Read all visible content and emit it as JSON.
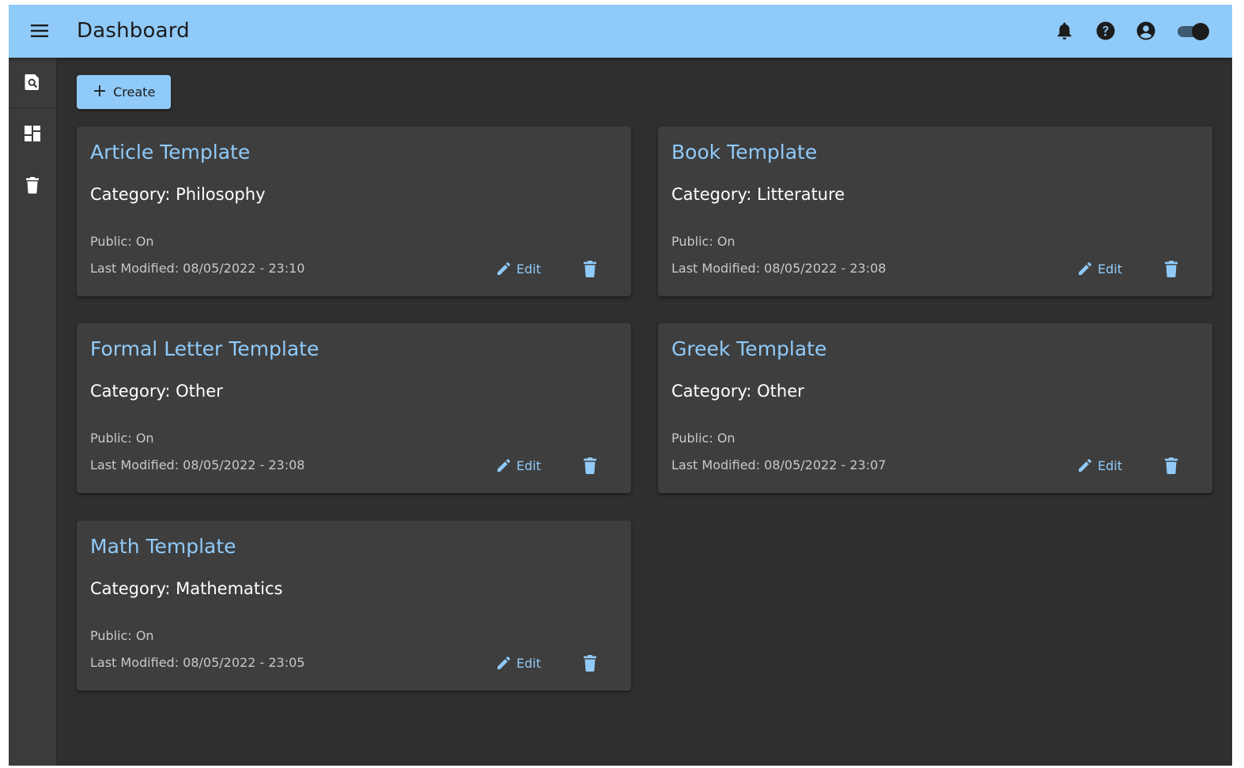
{
  "header": {
    "title": "Dashboard",
    "menu_icon": "hamburger-menu-icon",
    "icons": [
      "bell-icon",
      "help-circle-icon",
      "account-circle-icon"
    ],
    "theme_toggle": {
      "on": true
    }
  },
  "sidebar": {
    "items": [
      {
        "icon": "file-search-icon"
      },
      {
        "icon": "dashboard-icon"
      },
      {
        "icon": "trash-icon"
      }
    ]
  },
  "toolbar": {
    "create_label": "Create",
    "create_icon": "plus-icon"
  },
  "cards": [
    {
      "title": "Article Template",
      "category": "Category: Philosophy",
      "public": "Public: On",
      "modified": "Last Modified: 08/05/2022 - 23:10",
      "edit_label": "Edit"
    },
    {
      "title": "Book Template",
      "category": "Category: Litterature",
      "public": "Public: On",
      "modified": "Last Modified: 08/05/2022 - 23:08",
      "edit_label": "Edit"
    },
    {
      "title": "Formal Letter Template",
      "category": "Category: Other",
      "public": "Public: On",
      "modified": "Last Modified: 08/05/2022 - 23:08",
      "edit_label": "Edit"
    },
    {
      "title": "Greek Template",
      "category": "Category: Other",
      "public": "Public: On",
      "modified": "Last Modified: 08/05/2022 - 23:07",
      "edit_label": "Edit"
    },
    {
      "title": "Math Template",
      "category": "Category: Mathematics",
      "public": "Public: On",
      "modified": "Last Modified: 08/05/2022 - 23:05",
      "edit_label": "Edit"
    }
  ],
  "colors": {
    "accent": "#90caf9",
    "background": "#2f2f2f",
    "card": "#3e3e3e",
    "sidebar": "#3b3b3b"
  }
}
